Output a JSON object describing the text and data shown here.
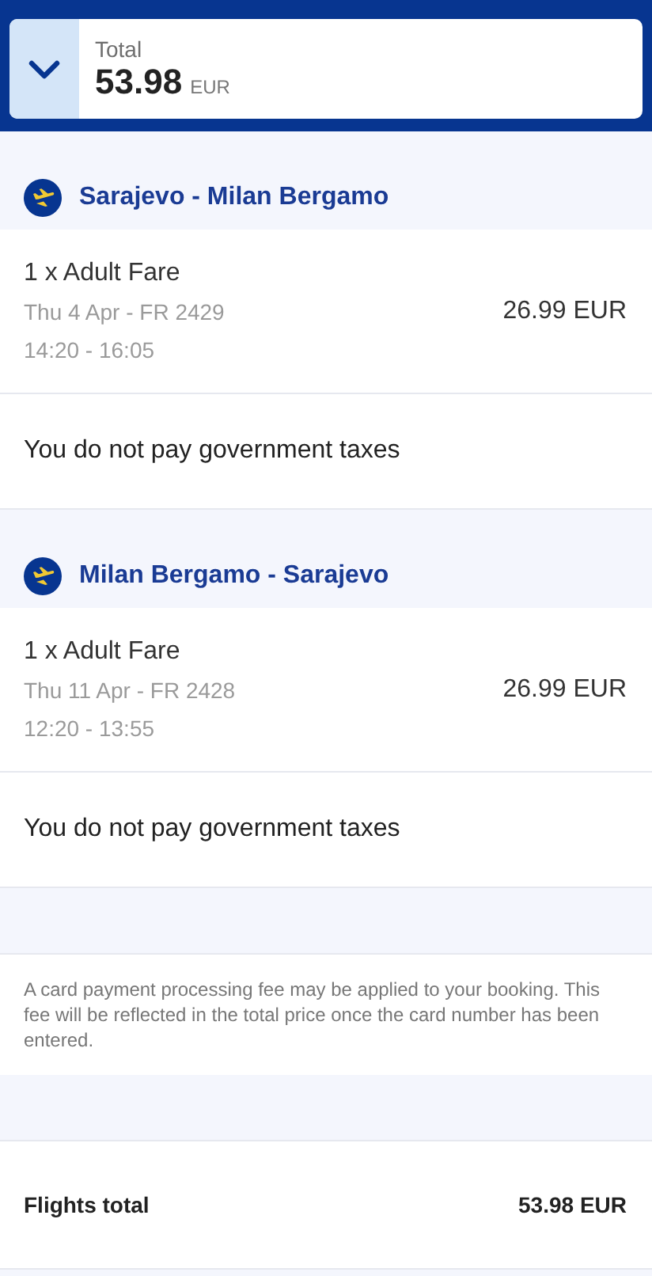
{
  "summary": {
    "label": "Total",
    "amount": "53.98",
    "currency": "EUR",
    "expanded": false
  },
  "flights": [
    {
      "route": "Sarajevo - Milan Bergamo",
      "fare": "1 x Adult Fare",
      "date_flight": "Thu 4 Apr - FR 2429",
      "times": "14:20 - 16:05",
      "price": "26.99 EUR",
      "taxes_note": "You do not pay government taxes"
    },
    {
      "route": "Milan Bergamo - Sarajevo",
      "fare": "1 x Adult Fare",
      "date_flight": "Thu 11 Apr - FR 2428",
      "times": "12:20 - 13:55",
      "price": "26.99 EUR",
      "taxes_note": "You do not pay government taxes"
    }
  ],
  "fee_note": "A card payment processing fee may be applied to your booking. This fee will be reflected in the total price once the card number has been entered.",
  "flights_total": {
    "label": "Flights total",
    "amount": "53.98 EUR"
  }
}
